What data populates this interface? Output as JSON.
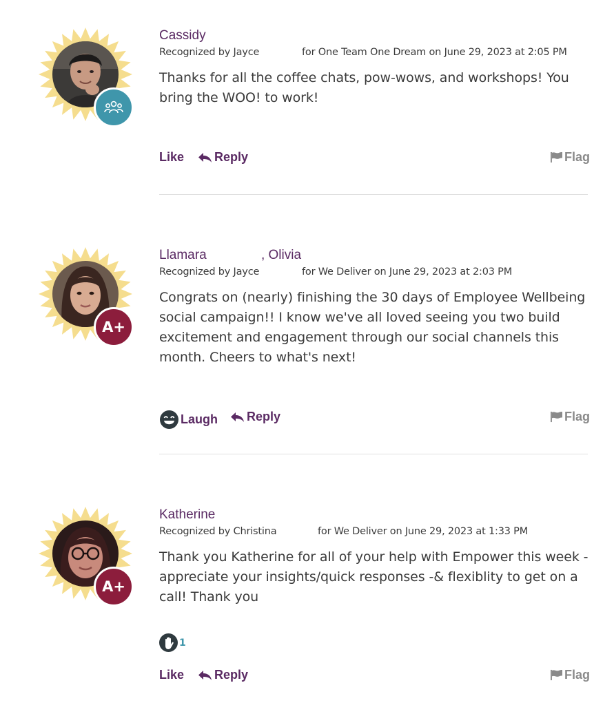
{
  "posts": [
    {
      "recipients": [
        "Cassidy"
      ],
      "recognized_by": "Recognized by Jayce",
      "for_text": "for One Team One Dream on June 29, 2023 at 2:05 PM",
      "message": "Thanks for all the coffee chats, pow-wows, and workshops! You bring the WOO! to work!",
      "badge": "team-icon",
      "actions": {
        "like": "Like",
        "reply": "Reply",
        "flag": "Flag"
      }
    },
    {
      "recipients": [
        "Llamara",
        ", Olivia"
      ],
      "recognized_by": "Recognized by Jayce",
      "for_text": "for We Deliver on June 29, 2023 at 2:03 PM",
      "message": "Congrats on (nearly) finishing the 30 days of Employee Wellbeing social campaign!! I know we've all loved seeing you two build excitement and engagement through our social channels this month. Cheers to what's next!",
      "badge": "A+",
      "actions": {
        "laugh": "Laugh",
        "reply": "Reply",
        "flag": "Flag"
      }
    },
    {
      "recipients": [
        "Katherine"
      ],
      "recognized_by": "Recognized by Christina",
      "for_text": "for We Deliver on June 29, 2023 at 1:33 PM",
      "message": "Thank you Katherine for all of your help with Empower this week - appreciate your insights/quick responses -& flexiblity to get on a call! Thank you",
      "badge": "A+",
      "reaction_count": "1",
      "actions": {
        "like": "Like",
        "reply": "Reply",
        "flag": "Flag"
      }
    }
  ],
  "colors": {
    "name": "#5a2a63",
    "burst": "#f5dd8e",
    "team_badge": "#3f96ab",
    "aplus_badge": "#8c1d3c",
    "flag": "#8a8a8a"
  }
}
